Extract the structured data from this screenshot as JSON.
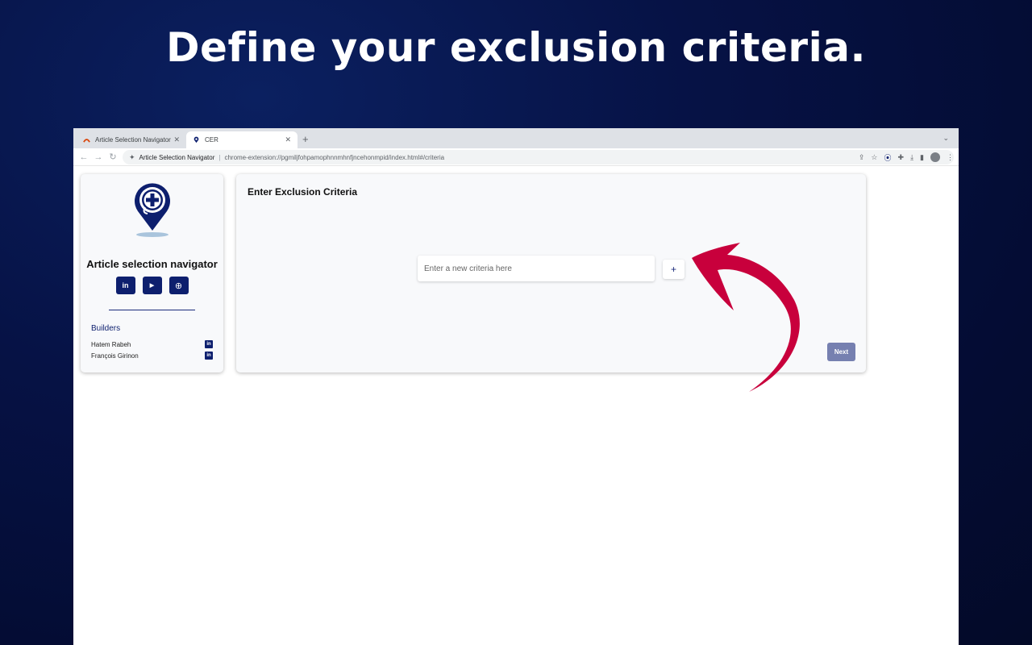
{
  "headline": "Define your exclusion criteria.",
  "browser": {
    "tabs": [
      {
        "label": "Article Selection Navigator",
        "icon": "app-favicon",
        "active": false
      },
      {
        "label": "CER",
        "icon": "location-pin-favicon",
        "active": true
      }
    ],
    "omnibox": {
      "site_name": "Article Selection Navigator",
      "url": "chrome-extension://pgmiljfohpamophnnmhnfjncehonmpid/index.html#/criteria"
    }
  },
  "sidebar": {
    "app_name": "Article selection navigator",
    "social_links": [
      {
        "icon": "linkedin-icon",
        "glyph": "in"
      },
      {
        "icon": "youtube-icon",
        "glyph": "▶"
      },
      {
        "icon": "globe-icon",
        "glyph": "⊕"
      }
    ],
    "builders_title": "Builders",
    "builders": [
      {
        "name": "Hatem Rabeh",
        "icon": "linkedin-icon"
      },
      {
        "name": "François Girinon",
        "icon": "linkedin-icon"
      }
    ]
  },
  "main": {
    "title": "Enter Exclusion Criteria",
    "criteria_placeholder": "Enter a new criteria here",
    "add_label": "+",
    "next_label": "Next"
  },
  "colors": {
    "brand_navy": "#0d1f6e",
    "arrow": "#c8003c",
    "next_button": "#7680b0"
  }
}
